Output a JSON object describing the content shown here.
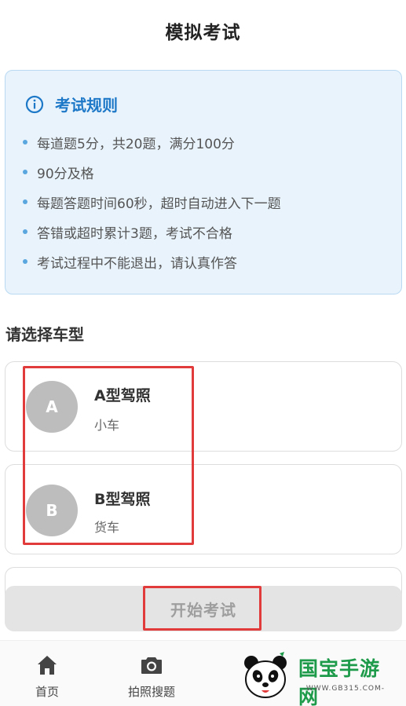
{
  "header": {
    "title": "模拟考试"
  },
  "rules": {
    "title": "考试规则",
    "items": [
      "每道题5分，共20题，满分100分",
      "90分及格",
      "每题答题时间60秒，超时自动进入下一题",
      "答错或超时累计3题，考试不合格",
      "考试过程中不能退出，请认真作答"
    ]
  },
  "vehicle_section": {
    "title": "请选择车型",
    "options": [
      {
        "letter": "A",
        "name": "A型驾照",
        "desc": "小车"
      },
      {
        "letter": "B",
        "name": "B型驾照",
        "desc": "货车"
      }
    ]
  },
  "start_button": {
    "label": "开始考试"
  },
  "tabbar": {
    "items": [
      {
        "label": "首页",
        "icon": "home-icon"
      },
      {
        "label": "拍照搜题",
        "icon": "camera-icon"
      }
    ]
  },
  "watermark": {
    "brand": "国宝手游网",
    "url": "-WWW.GB315.COM-"
  },
  "colors": {
    "accent": "#1e78c8",
    "highlight": "#e23b3b",
    "rules_bg": "#e8f3fc",
    "avatar": "#bdbdbd"
  }
}
